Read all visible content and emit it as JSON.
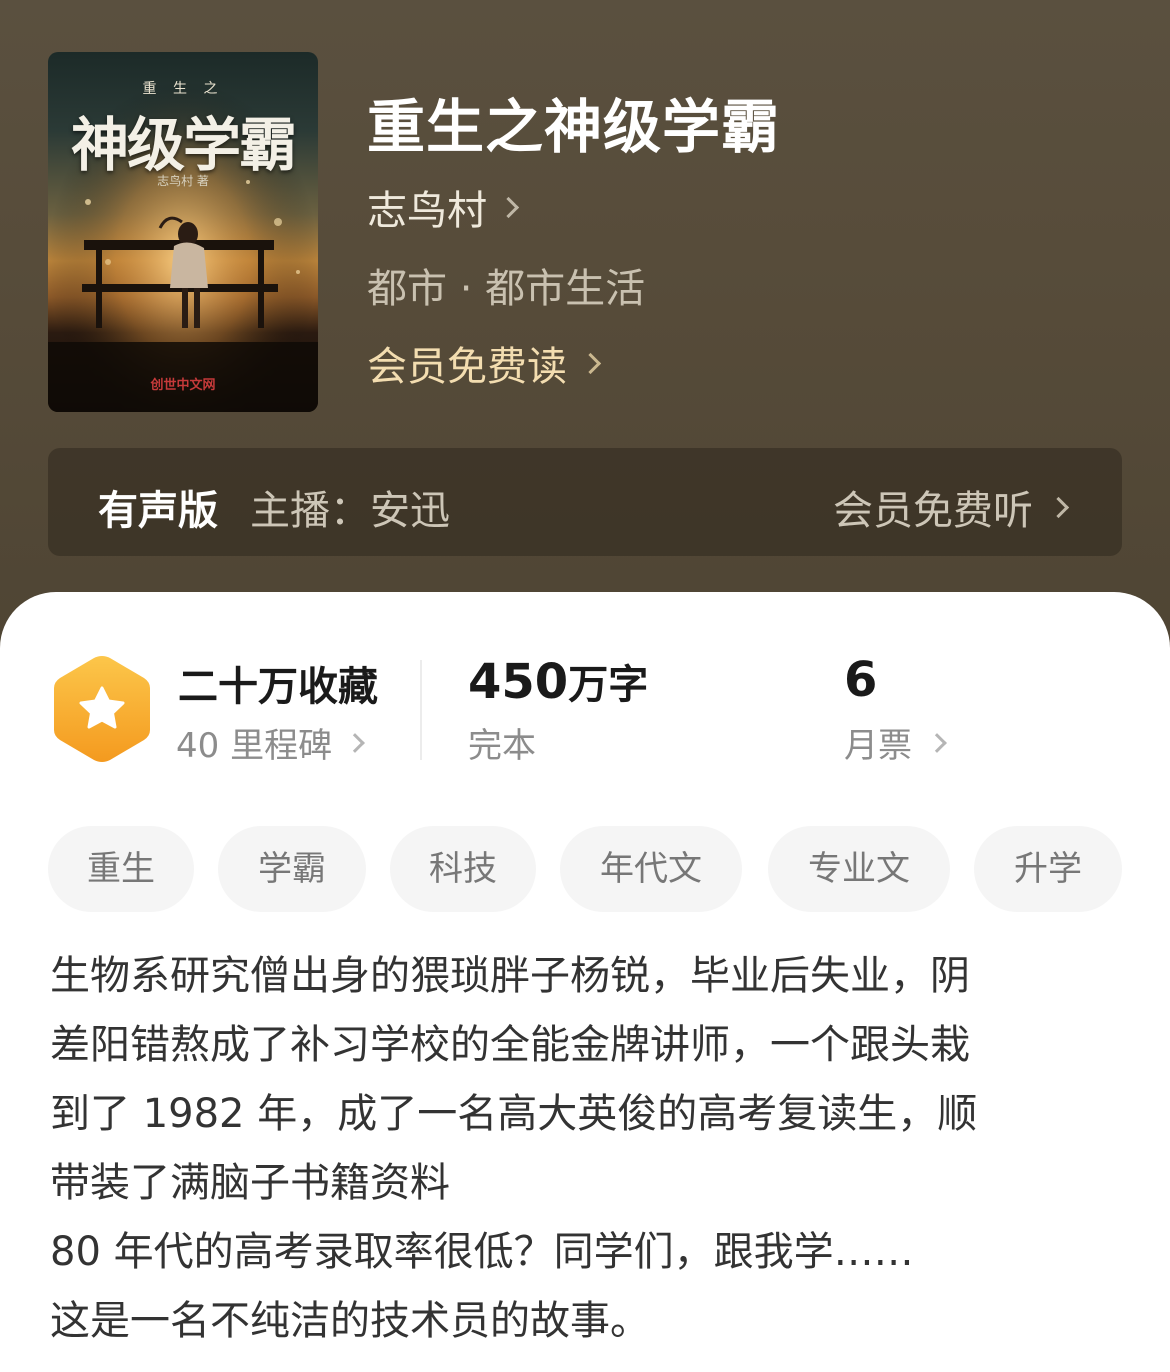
{
  "book": {
    "cover": {
      "small_title": "重 生 之",
      "title": "神级学霸",
      "author": "志鸟村 著",
      "publisher": "创世中文网"
    },
    "title": "重生之神级学霸",
    "author": "志鸟村",
    "genre": "都市 · 都市生活",
    "member_read": "会员免费读"
  },
  "audio": {
    "label": "有声版",
    "host": "主播：安迅",
    "listen": "会员免费听"
  },
  "stats": {
    "collect_main": "二十万收藏",
    "collect_sub": "40 里程碑",
    "words_num": "450",
    "words_unit": "万字",
    "status": "完本",
    "tickets_num": "6",
    "tickets_label": "月票"
  },
  "tags": [
    "重生",
    "学霸",
    "科技",
    "年代文",
    "专业文",
    "升学"
  ],
  "synopsis": [
    "生物系研究僧出身的猥琐胖子杨锐，毕业后失业，阴",
    "差阳错熬成了补习学校的全能金牌讲师，一个跟头栽",
    "到了 1982 年，成了一名高大英俊的高考复读生，顺",
    "带装了满脑子书籍资料",
    "80 年代的高考录取率很低？同学们，跟我学……",
    "这是一名不纯洁的技术员的故事。"
  ],
  "colors": {
    "header_bg": "#574c3a",
    "member_gold": "#f3ddb0",
    "badge_orange": "#f5a623"
  }
}
